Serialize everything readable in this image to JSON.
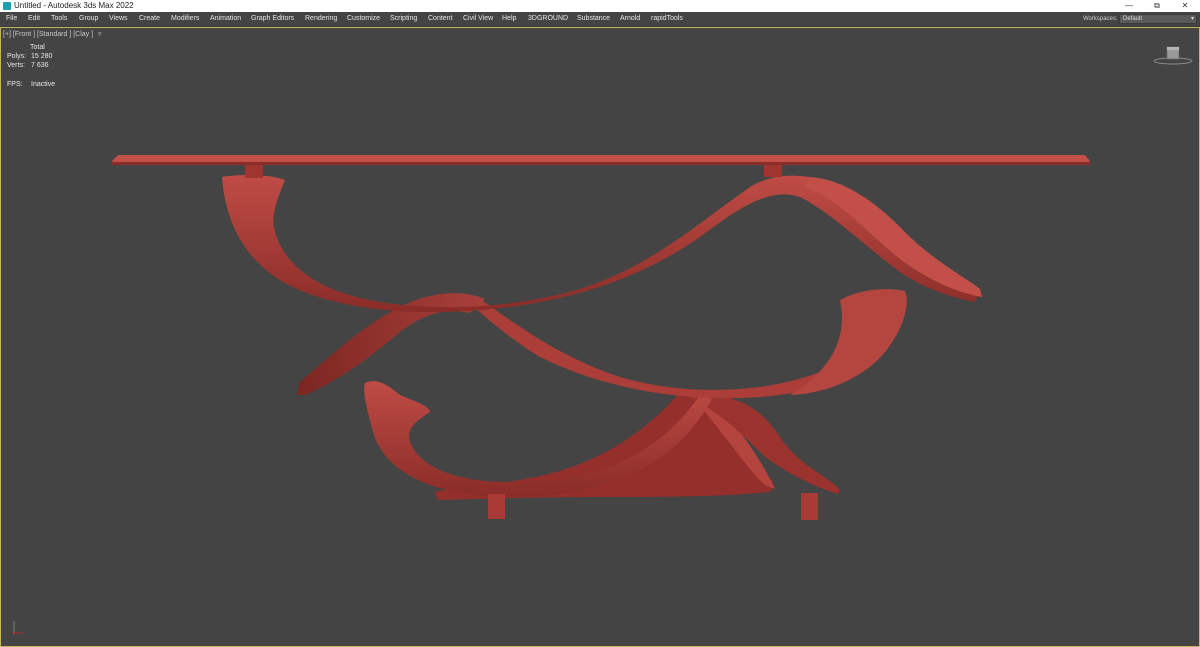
{
  "titlebar": {
    "title": "Untitled - Autodesk 3ds Max 2022",
    "minimize": "—",
    "restore": "⧉",
    "close": "✕"
  },
  "menubar": {
    "items": [
      "File",
      "Edit",
      "Tools",
      "Group",
      "Views",
      "Create",
      "Modifiers",
      "Animation",
      "Graph Editors",
      "Rendering",
      "Customize",
      "Scripting",
      "Content",
      "Civil View",
      "Help",
      "3DGROUND",
      "Substance",
      "Arnold",
      "rapidTools"
    ],
    "workspaces_label": "Workspaces:",
    "workspaces_value": "Default"
  },
  "viewport": {
    "label": "[+] [Front ] [Standard ] [Clay ]",
    "filter_icon": "funnel-icon",
    "stats": {
      "header": "Total",
      "polys_label": "Polys:",
      "polys_value": "15 280",
      "verts_label": "Verts:",
      "verts_value": "7 636",
      "fps_label": "FPS:",
      "fps_value": "Inactive"
    },
    "model_color": "#a33a35",
    "viewcube_icon": "viewcube-icon",
    "axis_icon": "axis-tripod-icon"
  }
}
